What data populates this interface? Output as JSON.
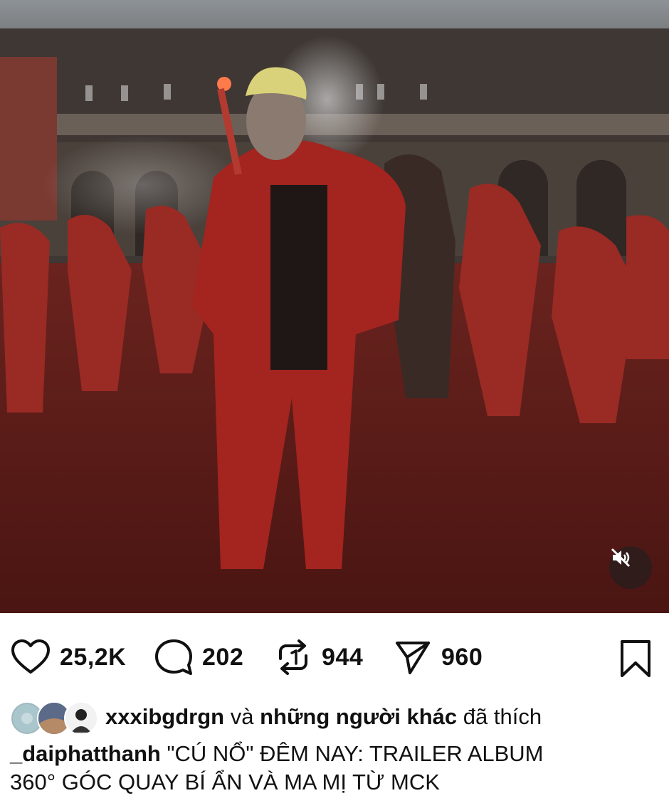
{
  "post": {
    "media": {
      "description_icon": "video-post",
      "mute_icon": "speaker-muted-icon"
    },
    "actions": {
      "like_count": "25,2K",
      "comment_count": "202",
      "repost_count": "944",
      "share_count": "960",
      "like_icon": "heart-icon",
      "comment_icon": "comment-bubble-icon",
      "repost_icon": "repost-icon",
      "share_icon": "send-icon",
      "save_icon": "bookmark-icon"
    },
    "liked_by": {
      "username": "xxxibgdrgn",
      "connector": "và",
      "others": "những người khác",
      "suffix": "đã thích"
    },
    "caption": {
      "username": "_daiphatthanh",
      "text_line1": "\"CÚ NỔ\" ĐÊM NAY: TRAILER ALBUM",
      "text_line2": "360° GÓC QUAY BÍ ẨN VÀ MA MỊ TỪ MCK"
    }
  },
  "colors": {
    "accent_red": "#8e1e1e",
    "icon_dark": "#111111"
  }
}
